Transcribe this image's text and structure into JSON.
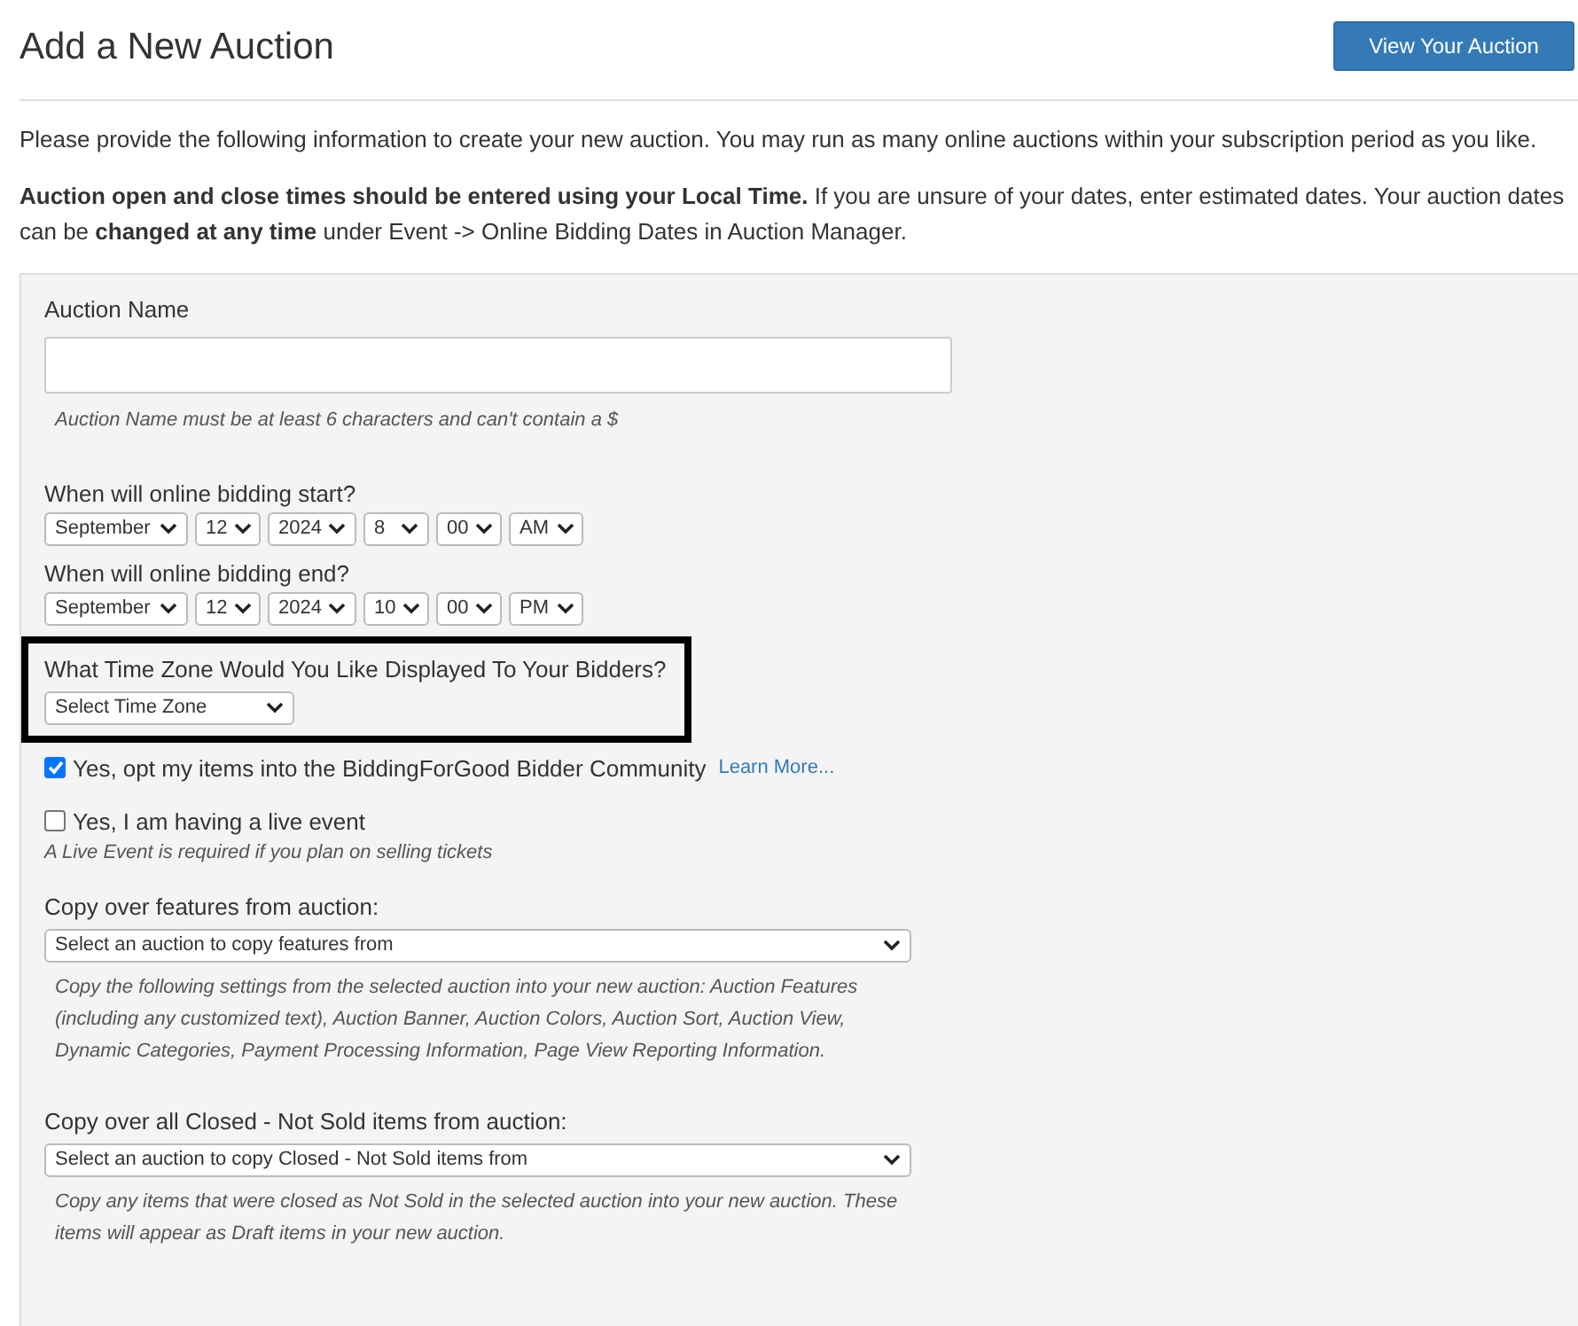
{
  "header": {
    "title": "Add a New Auction",
    "button": "View Your Auction"
  },
  "intro": [
    "Please provide the following information to create your new auction. You may run as many online auctions within your subscription period as you like.",
    "**Auction open and close times should be entered using your Local Time.** If you are unsure of your dates, enter estimated dates. Your auction dates can be **changed at any time** under Event -> Online Bidding Dates in Auction Manager."
  ],
  "form": {
    "auction_name": {
      "label": "Auction Name",
      "hint": "Auction Name must be at least 6 characters and can't contain a $"
    },
    "start": {
      "label": "When will online bidding start?",
      "selects": [
        "September",
        "12",
        "2024",
        "8",
        "00",
        "AM"
      ]
    },
    "end": {
      "label": "When will online bidding end?",
      "selects": [
        "September",
        "12",
        "2024",
        "10",
        "00",
        "PM"
      ]
    },
    "time_zone": {
      "label": "What Time Zone Would You Like Displayed To Your Bidders?",
      "select": "Select Time Zone",
      "highlighted": true
    },
    "checkboxes": [
      {
        "label": "Yes, opt my items into the BiddingForGood Bidder Community",
        "checked": true,
        "link": "Learn More..."
      },
      {
        "label": "Yes, I am having a live event",
        "checked": false,
        "note": "A Live Event is required if you plan on selling tickets"
      }
    ],
    "copy_sections": [
      {
        "label": "Copy over features from auction:",
        "select": "Select an auction to copy features from",
        "description": "Copy the following settings from the selected auction into your new auction: Auction Features (including any customized text), Auction Banner, Auction Colors, Auction Sort, Auction View, Dynamic Categories, Payment Processing Information, Page View Reporting Information."
      },
      {
        "label": "Copy over all Closed - Not Sold items from auction:",
        "select": "Select an auction to copy Closed - Not Sold items from",
        "description": "Copy any items that were closed as Not Sold in the selected auction into your new auction. These items will appear as Draft items in your new auction."
      }
    ]
  }
}
